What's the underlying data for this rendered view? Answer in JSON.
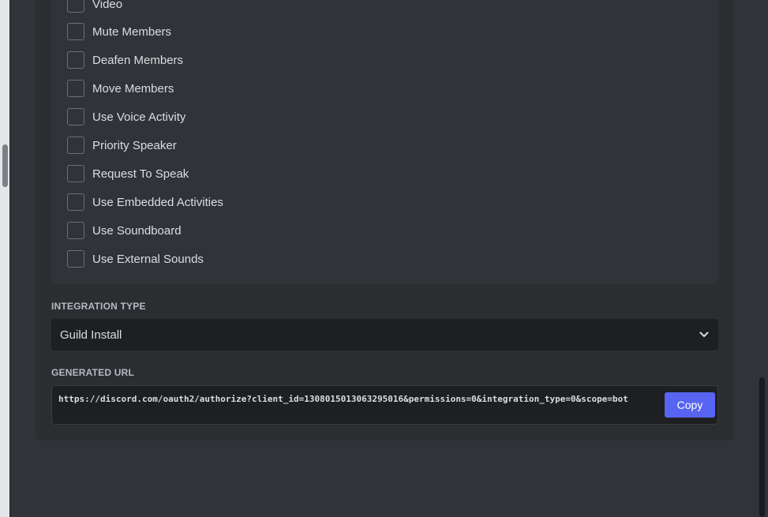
{
  "permissions": [
    {
      "label": "Video",
      "checked": false
    },
    {
      "label": "Mute Members",
      "checked": false
    },
    {
      "label": "Deafen Members",
      "checked": false
    },
    {
      "label": "Move Members",
      "checked": false
    },
    {
      "label": "Use Voice Activity",
      "checked": false
    },
    {
      "label": "Priority Speaker",
      "checked": false
    },
    {
      "label": "Request To Speak",
      "checked": false
    },
    {
      "label": "Use Embedded Activities",
      "checked": false
    },
    {
      "label": "Use Soundboard",
      "checked": false
    },
    {
      "label": "Use External Sounds",
      "checked": false
    }
  ],
  "integration_type": {
    "heading": "INTEGRATION TYPE",
    "selected": "Guild Install",
    "icon": "chevron-down-icon"
  },
  "generated_url": {
    "heading": "GENERATED URL",
    "url": "https://discord.com/oauth2/authorize?client_id=1308015013063295016&permissions=0&integration_type=0&scope=bot",
    "copy_label": "Copy"
  },
  "colors": {
    "accent": "#5865f2",
    "background": "#313338",
    "panel": "#2b2d31",
    "input": "#1e1f22"
  }
}
